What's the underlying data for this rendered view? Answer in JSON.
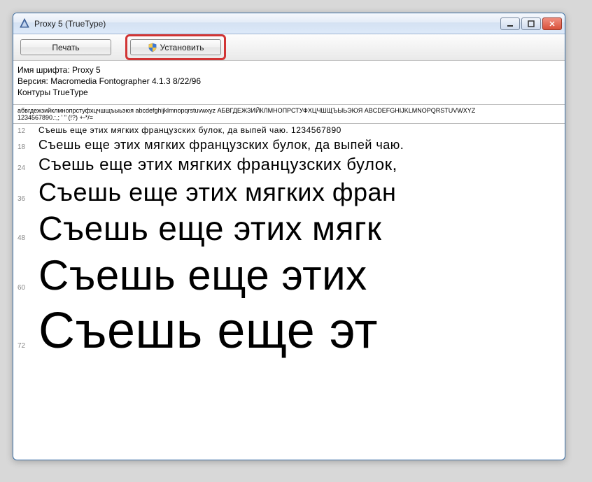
{
  "window": {
    "title": "Proxy 5 (TrueType)"
  },
  "toolbar": {
    "print_label": "Печать",
    "install_label": "Установить"
  },
  "info": {
    "font_name_label": "Имя шрифта:",
    "font_name_value": "Proxy 5",
    "version_label": "Версия:",
    "version_value": "Macromedia Fontographer 4.1.3 8/22/96",
    "outlines": "Контуры TrueType"
  },
  "alphabet": {
    "line1": "абвгдежзийклмнопрстуфхцчшщъыьэюя  abcdefghijklmnopqrstuvwxyz  АБВГДЕЖЗИЙКЛМНОПРСТУФХЦЧШЩЪЫЬЭЮЯ  ABCDEFGHIJKLMNOPQRSTUVWXYZ",
    "line2": "1234567890.:,; ' \" (!?) +-*/="
  },
  "pangram_base": "Съешь еще этих мягких французских булок, да выпей чаю.",
  "pangram_digits": "1234567890",
  "samples": [
    {
      "size": 12,
      "text": "Съешь еще этих мягких французских булок, да выпей чаю."
    },
    {
      "size": 18,
      "text": "Съешь еще этих мягких французских булок, да выпей чаю."
    },
    {
      "size": 24,
      "text": "Съешь еще этих мягких французских булок,"
    },
    {
      "size": 36,
      "text": "Съешь еще этих мягких фран"
    },
    {
      "size": 48,
      "text": "Съешь еще этих мягк"
    },
    {
      "size": 60,
      "text": "Съешь еще этих"
    },
    {
      "size": 72,
      "text": "Съешь еще эт"
    }
  ]
}
